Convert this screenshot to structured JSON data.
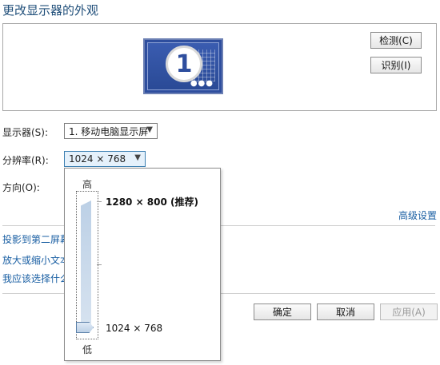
{
  "window": {
    "title": "更改显示器的外观"
  },
  "preview": {
    "monitor_number": "1",
    "detect_label": "检测(C)",
    "identify_label": "识别(I)"
  },
  "settings": {
    "display_label": "显示器(S):",
    "display_value": "1. 移动电脑显示屏",
    "resolution_label": "分辨率(R):",
    "resolution_value": "1024 × 768",
    "orientation_label": "方向(O):"
  },
  "resolution_popup": {
    "high_label": "高",
    "low_label": "低",
    "max_option": "1280 × 800 (推荐)",
    "current_option": "1024 × 768"
  },
  "advanced_link": "高级设置",
  "links": [
    "投影到第二屏幕",
    "放大或缩小文本",
    "我应该选择什么"
  ],
  "footer": {
    "ok_label": "确定",
    "cancel_label": "取消",
    "apply_label": "应用(A)"
  }
}
